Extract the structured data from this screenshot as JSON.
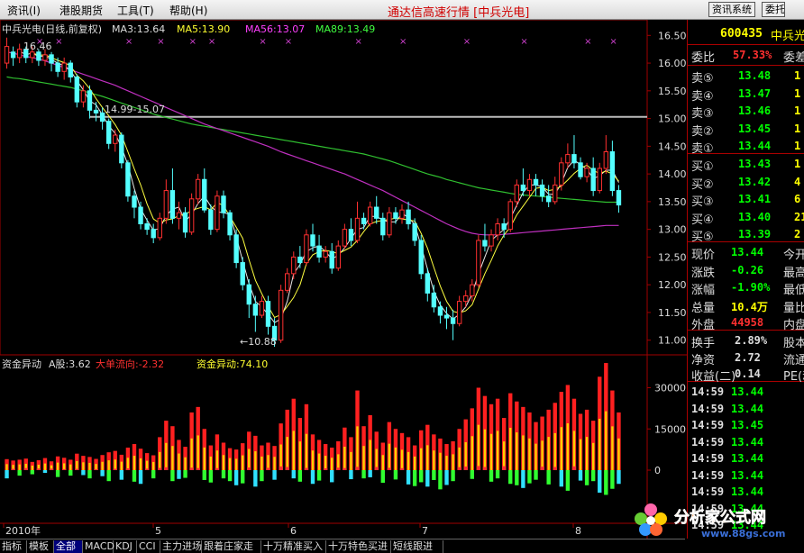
{
  "menu": {
    "items": [
      "资讯(I)",
      "港股期货",
      "工具(T)",
      "帮助(H)"
    ],
    "title": "通达信高速行情 [中兵光电]",
    "buttons": [
      "资讯系统",
      "委托交易"
    ]
  },
  "chart_header": {
    "name": "中兵光电(日线,前复权)",
    "ma3": "MA3:13.64",
    "ma5": "MA5:13.90",
    "ma56": "MA56:13.07",
    "ma89": "MA89:13.49"
  },
  "annotations": {
    "high": "16.46",
    "low": "←10.88",
    "band": "14.99-15.07"
  },
  "indicator_header": {
    "name": "资金异动",
    "a_share": "A股:3.62",
    "big_flow": "大单流向:-2.32",
    "fund": "资金异动:74.10"
  },
  "price_axis": [
    "16.50",
    "16.00",
    "15.50",
    "15.00",
    "14.50",
    "14.00",
    "13.50",
    "13.00",
    "12.50",
    "12.00",
    "11.50",
    "11.00"
  ],
  "ind_axis": [
    "30000",
    "15000",
    "0"
  ],
  "x_labels": [
    "2010年",
    "5",
    "6",
    "7",
    "8"
  ],
  "bottom_tabs": [
    "指标",
    "模板",
    "全部",
    "MACD",
    "KDJ",
    "CCI",
    "主力进场",
    "跟着庄家走",
    "十万精准买入",
    "十万特色买进",
    "短线跟进"
  ],
  "panel": {
    "code": "600435",
    "stock": "中兵光电",
    "weibi_label": "委比",
    "weibi_value": "57.33%",
    "weicha_label": "委差",
    "sells": [
      {
        "label": "卖⑤",
        "price": "13.48",
        "vol": "1"
      },
      {
        "label": "卖④",
        "price": "13.47",
        "vol": "1"
      },
      {
        "label": "卖③",
        "price": "13.46",
        "vol": "1"
      },
      {
        "label": "卖②",
        "price": "13.45",
        "vol": "1"
      },
      {
        "label": "卖①",
        "price": "13.44",
        "vol": "1"
      }
    ],
    "buys": [
      {
        "label": "买①",
        "price": "13.43",
        "vol": "1"
      },
      {
        "label": "买②",
        "price": "13.42",
        "vol": "4"
      },
      {
        "label": "买③",
        "price": "13.41",
        "vol": "6"
      },
      {
        "label": "买④",
        "price": "13.40",
        "vol": "21"
      },
      {
        "label": "买⑤",
        "price": "13.39",
        "vol": "2"
      }
    ],
    "stats": [
      {
        "label": "现价",
        "value": "13.44",
        "extra": "今开",
        "color": "#00ff00"
      },
      {
        "label": "涨跌",
        "value": "-0.26",
        "extra": "最高",
        "color": "#00ff00"
      },
      {
        "label": "涨幅",
        "value": "-1.90%",
        "extra": "最低",
        "color": "#00ff00"
      },
      {
        "label": "总量",
        "value": "10.4万",
        "extra": "量比",
        "color": "#ffff00"
      },
      {
        "label": "外盘",
        "value": "44958",
        "extra": "内盘",
        "color": "#ff3030"
      }
    ],
    "stats2": [
      {
        "label": "换手",
        "value": "2.89%",
        "extra": "股本"
      },
      {
        "label": "净资",
        "value": "2.72",
        "extra": "流通"
      },
      {
        "label": "收益(二)",
        "value": "0.14",
        "extra": "PE(动"
      }
    ],
    "ticks": [
      {
        "time": "14:59",
        "price": "13.44"
      },
      {
        "time": "14:59",
        "price": "13.44"
      },
      {
        "time": "14:59",
        "price": "13.45"
      },
      {
        "time": "14:59",
        "price": "13.44"
      },
      {
        "time": "14:59",
        "price": "13.44"
      },
      {
        "time": "14:59",
        "price": "13.44"
      },
      {
        "time": "14:59",
        "price": "13.44"
      },
      {
        "time": "14:59",
        "price": "13.44"
      },
      {
        "time": "14:59",
        "price": "13.44"
      }
    ]
  },
  "watermark": {
    "title": "分析家公式网",
    "url": "www.88gs.com"
  },
  "chart_data": {
    "type": "candlestick",
    "ylim": [
      10.8,
      16.7
    ],
    "candles": [
      [
        16.0,
        16.3,
        16.46,
        15.9
      ],
      [
        16.2,
        16.1,
        16.3,
        15.95
      ],
      [
        16.1,
        16.25,
        16.35,
        16.0
      ],
      [
        16.25,
        16.1,
        16.3,
        16.0
      ],
      [
        16.1,
        16.2,
        16.3,
        16.0
      ],
      [
        16.2,
        16.05,
        16.25,
        15.95
      ],
      [
        16.05,
        16.15,
        16.25,
        15.95
      ],
      [
        16.15,
        16.0,
        16.2,
        15.85
      ],
      [
        16.0,
        15.85,
        16.1,
        15.75
      ],
      [
        15.85,
        16.0,
        16.1,
        15.7
      ],
      [
        16.0,
        15.75,
        16.05,
        15.65
      ],
      [
        15.75,
        15.3,
        15.8,
        15.2
      ],
      [
        15.3,
        15.5,
        15.6,
        15.2
      ],
      [
        15.5,
        15.15,
        15.6,
        15.0
      ],
      [
        15.15,
        15.1,
        15.3,
        14.95
      ],
      [
        15.1,
        14.95,
        15.2,
        14.8
      ],
      [
        14.95,
        14.55,
        15.0,
        14.45
      ],
      [
        14.55,
        14.7,
        14.8,
        14.4
      ],
      [
        14.7,
        14.2,
        14.75,
        14.1
      ],
      [
        14.2,
        13.6,
        14.25,
        13.5
      ],
      [
        13.6,
        13.4,
        13.7,
        13.2
      ],
      [
        13.4,
        13.1,
        13.5,
        13.0
      ],
      [
        13.1,
        13.0,
        13.2,
        12.9
      ],
      [
        13.0,
        12.85,
        13.1,
        12.75
      ],
      [
        12.85,
        13.2,
        13.3,
        12.8
      ],
      [
        13.2,
        13.7,
        13.9,
        13.1
      ],
      [
        13.7,
        13.2,
        14.1,
        13.1
      ],
      [
        13.2,
        13.3,
        13.5,
        13.0
      ],
      [
        13.3,
        12.95,
        13.4,
        12.85
      ],
      [
        12.95,
        13.55,
        13.65,
        12.9
      ],
      [
        13.55,
        13.9,
        14.0,
        13.45
      ],
      [
        13.9,
        13.35,
        14.1,
        13.3
      ],
      [
        13.35,
        13.0,
        13.45,
        12.9
      ],
      [
        13.0,
        13.6,
        13.7,
        12.95
      ],
      [
        13.6,
        13.3,
        13.7,
        13.2
      ],
      [
        13.3,
        12.9,
        13.35,
        12.8
      ],
      [
        12.9,
        12.4,
        13.0,
        12.3
      ],
      [
        12.4,
        12.0,
        12.5,
        11.9
      ],
      [
        12.0,
        11.65,
        12.1,
        11.4
      ],
      [
        11.65,
        11.45,
        11.8,
        11.15
      ],
      [
        11.45,
        11.7,
        11.8,
        11.4
      ],
      [
        11.7,
        11.25,
        11.8,
        11.1
      ],
      [
        11.25,
        11.0,
        11.4,
        10.88
      ],
      [
        11.0,
        11.9,
        12.0,
        10.95
      ],
      [
        11.9,
        12.2,
        12.3,
        11.85
      ],
      [
        12.2,
        12.5,
        12.6,
        12.1
      ],
      [
        12.5,
        12.4,
        12.7,
        12.3
      ],
      [
        12.4,
        12.9,
        13.0,
        12.35
      ],
      [
        12.9,
        12.7,
        13.1,
        12.6
      ],
      [
        12.7,
        12.5,
        12.9,
        12.4
      ],
      [
        12.5,
        12.6,
        12.7,
        12.4
      ],
      [
        12.6,
        12.3,
        12.75,
        12.2
      ],
      [
        12.3,
        12.7,
        12.8,
        12.25
      ],
      [
        12.7,
        13.0,
        13.1,
        12.65
      ],
      [
        13.0,
        12.8,
        13.2,
        12.7
      ],
      [
        12.8,
        13.2,
        13.5,
        12.75
      ],
      [
        13.2,
        13.1,
        13.3,
        13.0
      ],
      [
        13.1,
        13.4,
        13.5,
        13.05
      ],
      [
        13.4,
        13.2,
        13.6,
        13.1
      ],
      [
        13.2,
        12.9,
        13.3,
        12.8
      ],
      [
        12.9,
        13.3,
        13.4,
        12.85
      ],
      [
        13.3,
        13.2,
        13.4,
        13.1
      ],
      [
        13.2,
        13.35,
        13.45,
        13.1
      ],
      [
        13.35,
        13.1,
        13.5,
        13.0
      ],
      [
        13.1,
        12.8,
        13.2,
        12.7
      ],
      [
        12.8,
        12.2,
        12.9,
        12.1
      ],
      [
        12.2,
        11.85,
        12.3,
        11.7
      ],
      [
        11.85,
        11.6,
        12.0,
        11.5
      ],
      [
        11.6,
        11.45,
        11.7,
        11.3
      ],
      [
        11.45,
        11.4,
        11.6,
        11.2
      ],
      [
        11.4,
        11.3,
        11.55,
        11.0
      ],
      [
        11.3,
        11.7,
        11.8,
        11.25
      ],
      [
        11.7,
        11.8,
        11.9,
        11.6
      ],
      [
        11.8,
        12.0,
        12.1,
        11.7
      ],
      [
        12.0,
        12.8,
        12.9,
        11.95
      ],
      [
        12.8,
        12.7,
        13.1,
        12.6
      ],
      [
        12.7,
        12.9,
        13.0,
        12.6
      ],
      [
        12.9,
        13.1,
        13.2,
        12.8
      ],
      [
        13.1,
        13.0,
        13.2,
        12.85
      ],
      [
        13.0,
        13.5,
        13.55,
        12.95
      ],
      [
        13.5,
        13.8,
        13.9,
        13.4
      ],
      [
        13.8,
        13.7,
        14.1,
        13.6
      ],
      [
        13.7,
        13.9,
        14.0,
        13.6
      ],
      [
        13.9,
        13.8,
        14.0,
        13.6
      ],
      [
        13.8,
        13.6,
        13.9,
        13.5
      ],
      [
        13.6,
        13.5,
        13.8,
        13.4
      ],
      [
        13.5,
        13.8,
        13.95,
        13.45
      ],
      [
        13.8,
        14.2,
        14.3,
        13.7
      ],
      [
        14.2,
        14.35,
        14.55,
        14.1
      ],
      [
        14.35,
        14.2,
        14.7,
        14.1
      ],
      [
        14.2,
        13.95,
        14.3,
        13.9
      ],
      [
        13.95,
        14.1,
        14.2,
        13.85
      ],
      [
        14.1,
        13.7,
        14.3,
        13.6
      ],
      [
        13.7,
        14.1,
        14.2,
        13.65
      ],
      [
        14.1,
        14.4,
        14.7,
        14.0
      ],
      [
        14.4,
        13.7,
        14.6,
        13.6
      ],
      [
        13.7,
        13.44,
        13.8,
        13.3
      ]
    ],
    "volume": [
      4000,
      3500,
      3800,
      4200,
      3000,
      3600,
      4400,
      3200,
      5000,
      4500,
      3800,
      6000,
      5200,
      4800,
      4100,
      5500,
      6500,
      7000,
      5600,
      8200,
      9500,
      7800,
      6200,
      5400,
      12000,
      18000,
      16000,
      11000,
      8500,
      21000,
      23000,
      15000,
      9000,
      13000,
      10000,
      8000,
      7500,
      9800,
      14000,
      12500,
      9000,
      10000,
      8800,
      17000,
      22000,
      26000,
      19000,
      24000,
      13000,
      11000,
      9500,
      8200,
      10500,
      15500,
      12000,
      29000,
      16000,
      20000,
      14000,
      10000,
      17500,
      15000,
      13500,
      12000,
      9000,
      14500,
      16500,
      13000,
      11500,
      9500,
      10500,
      15000,
      18500,
      22500,
      30000,
      27000,
      24000,
      26000,
      19000,
      28000,
      25000,
      23000,
      21000,
      17500,
      19500,
      22000,
      24500,
      28500,
      31000,
      26000,
      20500,
      22000,
      18000,
      34000,
      39000,
      29000,
      21000
    ],
    "flow": [
      -3000,
      1500,
      -2000,
      2500,
      -1500,
      2000,
      -1000,
      1800,
      -2500,
      1200,
      -2000,
      1500,
      -1800,
      -3000,
      1200,
      -2200,
      -4000,
      1600,
      -3500,
      2200,
      -4200,
      -5000,
      1800,
      -3000,
      2600,
      3500,
      -4000,
      -3200,
      -2800,
      3000,
      2500,
      -3600,
      -4500,
      2400,
      -3000,
      -4000,
      -5500,
      -4800,
      3200,
      -6000,
      -4000,
      2800,
      -3500,
      4500,
      3800,
      -3000,
      -4200,
      2600,
      -5000,
      -3800,
      2200,
      -4400,
      3000,
      2500,
      -3300,
      4000,
      -3000,
      -2600,
      3800,
      -4600,
      2800,
      -3400,
      2400,
      -5200,
      -5800,
      -4400,
      -6000,
      -3600,
      -7000,
      -5400,
      -4000,
      3600,
      4400,
      -3200,
      5000,
      3800,
      -4200,
      -3000,
      4800,
      -5000,
      -5500,
      -6500,
      -4800,
      -3500,
      4200,
      -5200,
      3800,
      -6000,
      -7500,
      4600,
      -3800,
      -5500,
      -4000,
      -8200,
      -9000,
      -6800,
      -5000
    ],
    "markers_bar_index": [
      5,
      8,
      19,
      24,
      29,
      32,
      40,
      44,
      55,
      62,
      72,
      81,
      91,
      95
    ],
    "ma_lines": [
      {
        "name": "MA89",
        "color": "#30c030",
        "values": [
          15.75,
          15.73,
          15.72,
          15.7,
          15.68,
          15.66,
          15.64,
          15.62,
          15.6,
          15.58,
          15.56,
          15.53,
          15.5,
          15.46,
          15.43,
          15.4,
          15.36,
          15.32,
          15.28,
          15.24,
          15.2,
          15.16,
          15.12,
          15.08,
          15.05,
          15.02,
          14.99,
          14.96,
          14.93,
          14.9,
          14.88,
          14.86,
          14.84,
          14.82,
          14.8,
          14.78,
          14.76,
          14.74,
          14.72,
          14.7,
          14.68,
          14.66,
          14.64,
          14.62,
          14.6,
          14.58,
          14.56,
          14.54,
          14.52,
          14.5,
          14.48,
          14.46,
          14.44,
          14.42,
          14.4,
          14.38,
          14.36,
          14.33,
          14.3,
          14.27,
          14.24,
          14.2,
          14.16,
          14.12,
          14.08,
          14.04,
          14.0,
          13.97,
          13.94,
          13.9,
          13.87,
          13.84,
          13.81,
          13.78,
          13.75,
          13.73,
          13.71,
          13.69,
          13.67,
          13.65,
          13.63,
          13.62,
          13.61,
          13.6,
          13.59,
          13.58,
          13.57,
          13.56,
          13.55,
          13.54,
          13.53,
          13.52,
          13.51,
          13.5,
          13.49,
          13.49,
          13.49
        ]
      },
      {
        "name": "MA56",
        "color": "#c030c0",
        "values": [
          16.2,
          16.18,
          16.15,
          16.12,
          16.1,
          16.07,
          16.04,
          16.0,
          15.96,
          15.92,
          15.88,
          15.84,
          15.8,
          15.76,
          15.72,
          15.68,
          15.64,
          15.6,
          15.55,
          15.5,
          15.45,
          15.4,
          15.35,
          15.3,
          15.25,
          15.2,
          15.15,
          15.1,
          15.05,
          15.0,
          14.95,
          14.9,
          14.86,
          14.82,
          14.78,
          14.74,
          14.7,
          14.66,
          14.62,
          14.58,
          14.54,
          14.5,
          14.45,
          14.4,
          14.36,
          14.32,
          14.28,
          14.24,
          14.2,
          14.16,
          14.12,
          14.08,
          14.04,
          14.0,
          13.95,
          13.9,
          13.85,
          13.8,
          13.75,
          13.7,
          13.64,
          13.58,
          13.52,
          13.46,
          13.4,
          13.34,
          13.28,
          13.22,
          13.16,
          13.1,
          13.05,
          13.0,
          12.96,
          12.93,
          12.91,
          12.9,
          12.9,
          12.9,
          12.91,
          12.92,
          12.93,
          12.94,
          12.95,
          12.96,
          12.97,
          12.98,
          12.99,
          13.0,
          13.01,
          13.02,
          13.03,
          13.04,
          13.05,
          13.06,
          13.07,
          13.07,
          13.07
        ]
      }
    ]
  }
}
